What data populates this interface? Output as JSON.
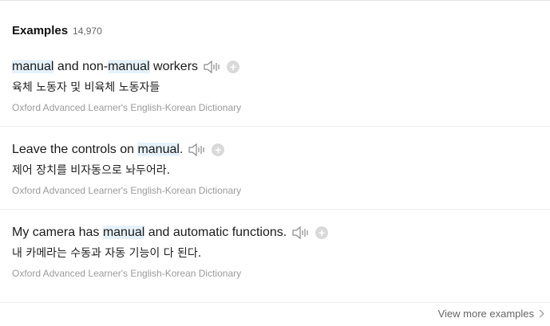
{
  "section": {
    "title": "Examples",
    "count": "14,970"
  },
  "examples": [
    {
      "en_parts": [
        {
          "text": "manual",
          "hl": true
        },
        {
          "text": " and non-",
          "hl": false
        },
        {
          "text": "manual",
          "hl": true
        },
        {
          "text": " workers",
          "hl": false
        }
      ],
      "ko": "육체 노동자 및 비육체 노동자들",
      "source": "Oxford Advanced Learner's English-Korean Dictionary"
    },
    {
      "en_parts": [
        {
          "text": "Leave the controls on ",
          "hl": false
        },
        {
          "text": "manual",
          "hl": true
        },
        {
          "text": ".",
          "hl": false
        }
      ],
      "ko": "제어 장치를 비자동으로 놔두어라.",
      "source": "Oxford Advanced Learner's English-Korean Dictionary"
    },
    {
      "en_parts": [
        {
          "text": "My camera has ",
          "hl": false
        },
        {
          "text": "manual",
          "hl": true
        },
        {
          "text": " and automatic functions.",
          "hl": false
        }
      ],
      "ko": "내 카메라는 수동과 자동 기능이 다 된다.",
      "source": "Oxford Advanced Learner's English-Korean Dictionary"
    }
  ],
  "icons": {
    "speaker": "speaker-icon",
    "add": "plus-icon",
    "chevron": "chevron-right-icon"
  },
  "colors": {
    "highlight": "#e6f2fb",
    "source_text": "#9a9a9a",
    "add_button": "#d9d9d9"
  },
  "footer": {
    "view_more": "View more examples"
  }
}
